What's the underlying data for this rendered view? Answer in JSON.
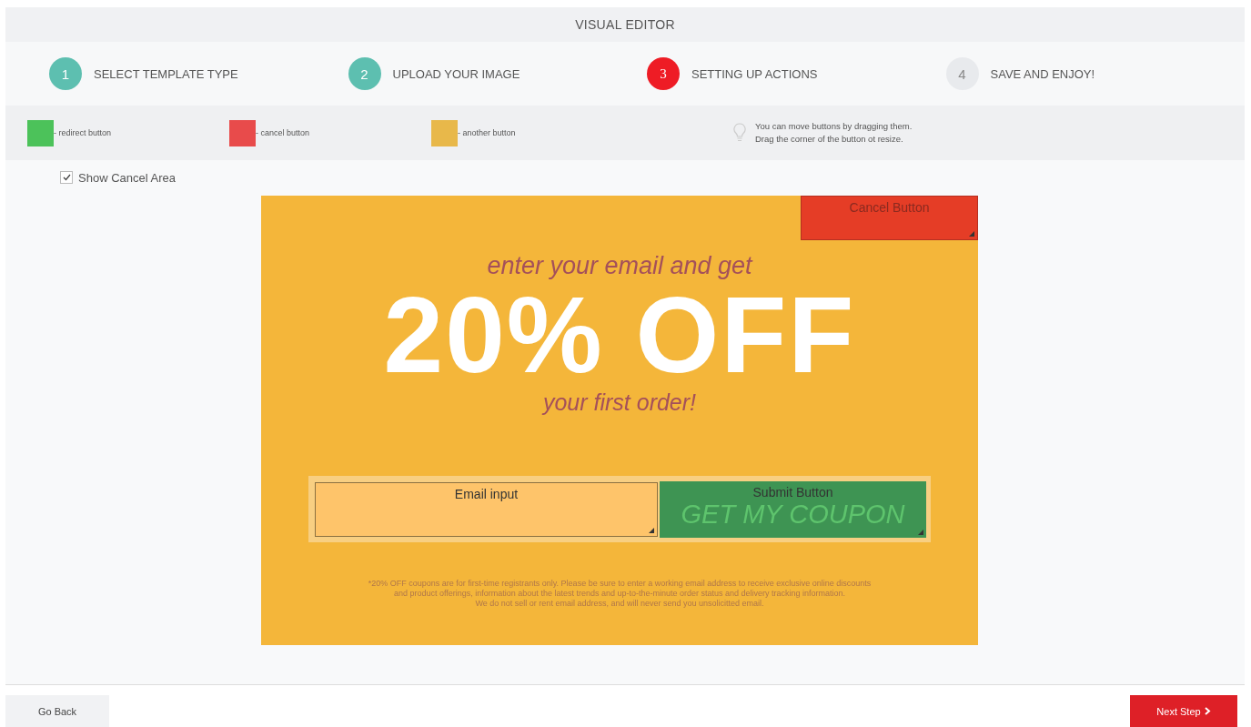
{
  "header": {
    "title": "VISUAL EDITOR"
  },
  "steps": [
    {
      "number": "1",
      "label": "SELECT TEMPLATE TYPE",
      "done": true,
      "selected": false
    },
    {
      "number": "2",
      "label": "UPLOAD YOUR IMAGE",
      "done": true,
      "selected": false
    },
    {
      "number": "3",
      "label": "SETTING UP ACTIONS",
      "done": false,
      "selected": true
    },
    {
      "number": "4",
      "label": "SAVE AND ENJOY!",
      "done": false,
      "selected": false
    }
  ],
  "legend": [
    {
      "label": "- redirect button",
      "color": "#4cc25a"
    },
    {
      "label": "- cancel button",
      "color": "#e84b4b"
    },
    {
      "label": "- another button",
      "color": "#e8b84a"
    }
  ],
  "hint": {
    "lines": [
      "You can move buttons by dragging them.",
      "Drag the corner of the button ot resize."
    ]
  },
  "show_cancel_area": {
    "label": "Show Cancel Area",
    "checked": true
  },
  "template": {
    "intro": "enter your email and get",
    "headline": "20% OFF",
    "subline": "your first order!",
    "coupon_text": "GET MY COUPON",
    "disclaimer": [
      "*20% OFF coupons are for first-time registrants only. Please be sure to enter a working email address to receive exclusive online discounts",
      "and product offerings, information about the latest trends and up-to-the-minute order status and delivery tracking information.",
      "We do not sell or rent email address, and will never send you unsolicitted email."
    ]
  },
  "actions": [
    {
      "kind": "cancel",
      "label": "Cancel Button"
    },
    {
      "kind": "input",
      "label": "Email input"
    },
    {
      "kind": "submit",
      "label": "Submit Button"
    }
  ],
  "footer": {
    "back": "Go Back",
    "next": "Next Step"
  }
}
